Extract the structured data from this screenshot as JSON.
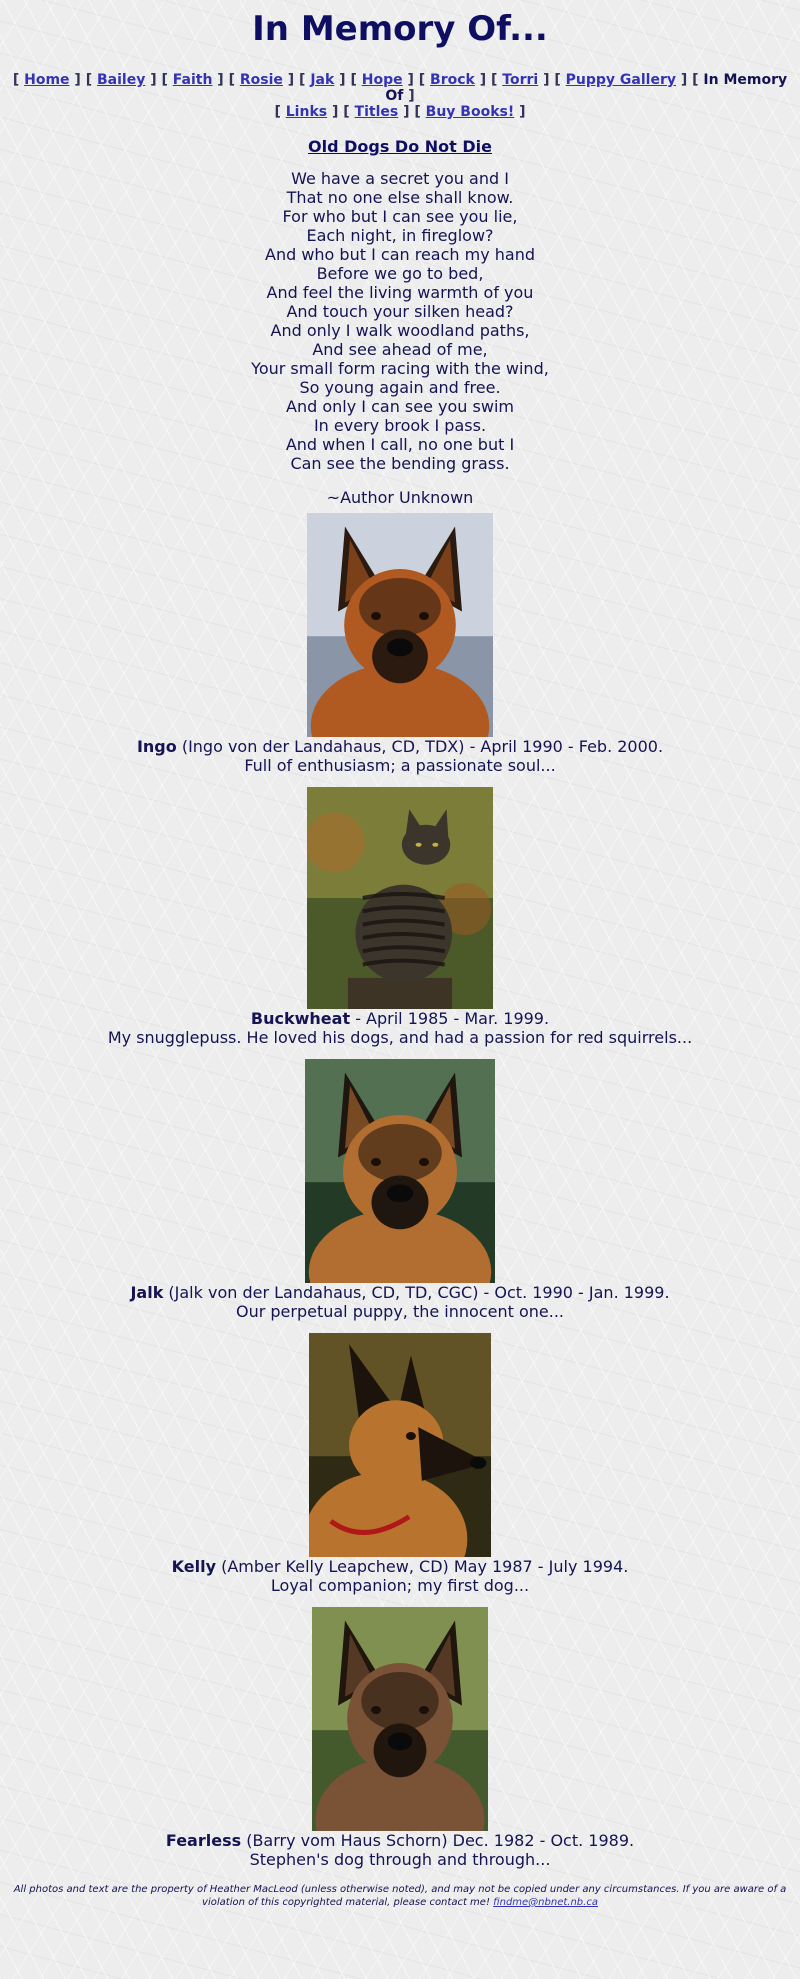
{
  "page": {
    "title": "In Memory Of..."
  },
  "nav": {
    "items": [
      {
        "label": "Home",
        "current": false
      },
      {
        "label": "Bailey",
        "current": false
      },
      {
        "label": "Faith",
        "current": false
      },
      {
        "label": "Rosie",
        "current": false
      },
      {
        "label": "Jak",
        "current": false
      },
      {
        "label": "Hope",
        "current": false
      },
      {
        "label": "Brock",
        "current": false
      },
      {
        "label": "Torri",
        "current": false
      },
      {
        "label": "Puppy Gallery",
        "current": false
      },
      {
        "label": "In Memory Of",
        "current": true
      },
      {
        "label": "Links",
        "current": false
      },
      {
        "label": "Titles",
        "current": false
      },
      {
        "label": "Buy Books!",
        "current": false
      }
    ]
  },
  "poem": {
    "title": "Old Dogs Do Not Die",
    "lines": [
      "We have a secret you and I",
      "That no one else shall know.",
      "For who but I can see you lie,",
      "Each night, in fireglow?",
      "And who but I can reach my hand",
      "Before we go to bed,",
      "And feel the living warmth of you",
      "And touch your silken head?",
      "And only I walk woodland paths,",
      "And see ahead of me,",
      "Your small form racing with the wind,",
      "So young again and free.",
      "And only I can see you swim",
      "In every brook I pass.",
      "And when I call, no one but I",
      "Can see the bending grass."
    ],
    "author": "~Author Unknown"
  },
  "memorials": [
    {
      "name": "Ingo",
      "detail": " (Ingo von der Landahaus, CD, TDX) - April 1990 - Feb. 2000.",
      "tribute": "Full of enthusiasm; a passionate soul...",
      "photo_kind": "dog",
      "colors": {
        "bg1": "#d6dde6",
        "bg2": "#8a96a8",
        "coat": "#b05a22",
        "dark": "#2a1a10"
      }
    },
    {
      "name": "Buckwheat",
      "detail": " - April 1985 - Mar. 1999.",
      "tribute": "My snugglepuss. He loved his dogs, and had a passion for red squirrels...",
      "photo_kind": "cat",
      "colors": {
        "bg1": "#8c8a3e",
        "bg2": "#4c5a2a",
        "coat": "#3c352c",
        "dark": "#181410"
      }
    },
    {
      "name": "Jalk",
      "detail": " (Jalk von der Landahaus, CD, TD, CGC) - Oct. 1990 - Jan. 1999.",
      "tribute": "Our perpetual puppy, the innocent one...",
      "photo_kind": "dog",
      "colors": {
        "bg1": "#5c7a5a",
        "bg2": "#223a26",
        "coat": "#b26e30",
        "dark": "#1f1610"
      }
    },
    {
      "name": "Kelly",
      "detail": " (Amber Kelly Leapchew, CD) May 1987 - July 1994.",
      "tribute": "Loyal companion; my first dog...",
      "photo_kind": "dog-profile",
      "colors": {
        "bg1": "#6a5a28",
        "bg2": "#2e2a14",
        "coat": "#b8742e",
        "dark": "#1c130c"
      }
    },
    {
      "name": "Fearless",
      "detail": " (Barry vom Haus Schorn) Dec. 1982 - Oct. 1989.",
      "tribute": "Stephen's dog through and through...",
      "photo_kind": "dog",
      "colors": {
        "bg1": "#8a9a58",
        "bg2": "#445a2c",
        "coat": "#7a5236",
        "dark": "#20160e"
      }
    }
  ],
  "footer": {
    "text": "All photos and text are the property of Heather MacLeod (unless otherwise noted), and may not be copied under any circumstances. If you are aware of a violation of this copyrighted material, please contact me! ",
    "email": "findme@nbnet.nb.ca"
  }
}
